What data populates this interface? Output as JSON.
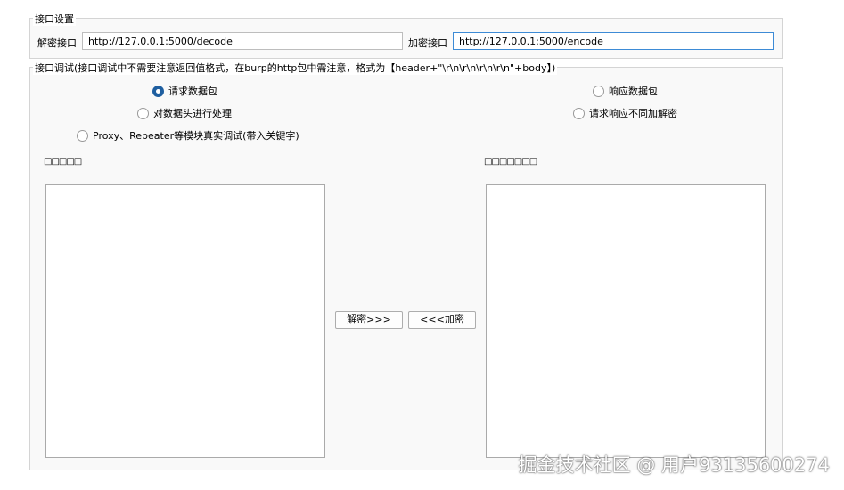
{
  "settings": {
    "legend": "接口设置",
    "decode_label": "解密接口",
    "decode_url": "http://127.0.0.1:5000/decode",
    "encode_label": "加密接口",
    "encode_url": "http://127.0.0.1:5000/encode"
  },
  "debug": {
    "legend": "接口调试(接口调试中不需要注意返回值格式，在burp的http包中需注意，格式为【header+\"\\r\\n\\r\\n\\r\\n\\r\\n\"+body】)",
    "radio_request": "请求数据包",
    "radio_response": "响应数据包",
    "radio_header": "对数据头进行处理",
    "radio_diff": "请求响应不同加解密",
    "radio_proxy": "Proxy、Repeater等模块真实调试(带入关键字)",
    "left_label": "□□□□□",
    "right_label": "□□□□□□□",
    "decrypt_button": "解密>>>",
    "encrypt_button": "<<<加密"
  },
  "watermark": "掘金技术社区 @ 用户93135600274"
}
